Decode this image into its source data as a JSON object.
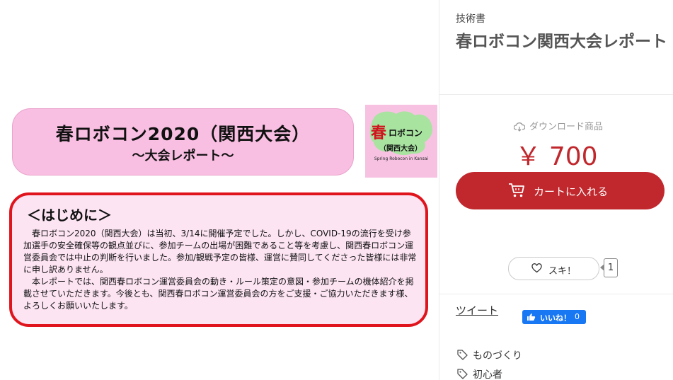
{
  "preview": {
    "title_line1": "春ロボコン2020（関西大会）",
    "title_line2": "～大会レポート～",
    "logo": {
      "haru": "春",
      "robocon": "ロボコン",
      "kansai": "（関西大会）",
      "spring": "Spring Robocon in Kansai"
    },
    "intro": {
      "heading": "＜はじめに＞",
      "paragraph1": "春ロボコン2020（関西大会）は当初、3/14に開催予定でした。しかし、COVID-19の流行を受け参加選手の安全確保等の観点並びに、参加チームの出場が困難であること等を考慮し、関西春ロボコン運営委員会では中止の判断を行いました。参加/観戦予定の皆様、運営に賛同してくださった皆様には非常に申し訳ありません。",
      "paragraph2": "本レポートでは、関西春ロボコン運営委員会の動き・ルール策定の意図・参加チームの機体紹介を掲載させていただきます。今後とも、関西春ロボコン運営委員会の方をご支援・ご協力いただきます様、よろしくお願いいたします。"
    }
  },
  "sidebar": {
    "category": "技術書",
    "title": "春ロボコン関西大会レポート",
    "download_label": "ダウンロード商品",
    "price": "￥ 700",
    "cart_button": "カートに入れる",
    "like_button": "スキ！",
    "like_count": "1",
    "tweet": "ツイート",
    "fb_like": {
      "label": "いいね！",
      "count": "0"
    },
    "tags": [
      "ものづくり",
      "初心者"
    ]
  },
  "colors": {
    "accent_red": "#c0282d",
    "banner_pink": "#f9bfe2",
    "intro_border": "#e0141c",
    "facebook_blue": "#1877f2"
  },
  "icons": [
    "cloud-download-icon",
    "cart-icon",
    "heart-icon",
    "facebook-thumb-icon",
    "tag-icon"
  ]
}
